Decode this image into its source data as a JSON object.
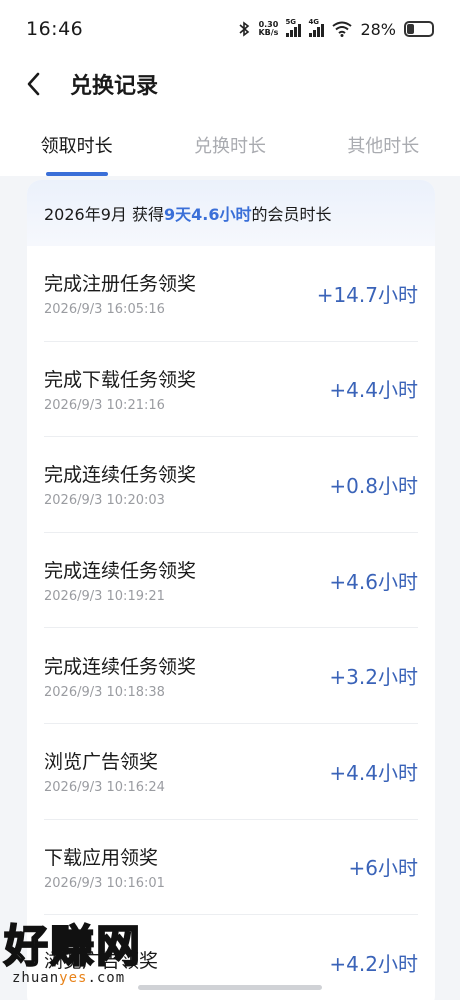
{
  "status_bar": {
    "time": "16:46",
    "bluetooth_icon": "bluetooth-icon",
    "net_speed_value": "0.30",
    "net_speed_unit": "KB/s",
    "signal1_label": "5G",
    "signal2_label": "4G",
    "battery_percent": "28%",
    "battery_level": 0.28
  },
  "nav": {
    "back_icon": "chevron-left-icon",
    "title": "兑换记录"
  },
  "tabs": [
    {
      "label": "领取时长",
      "active": true
    },
    {
      "label": "兑换时长",
      "active": false
    },
    {
      "label": "其他时长",
      "active": false
    }
  ],
  "summary": {
    "prefix": "2026年9月 获得",
    "highlight": "9天4.6小时",
    "suffix": "的会员时长"
  },
  "records": [
    {
      "title": "完成注册任务领奖",
      "time": "2026/9/3 16:05:16",
      "amount": "+14.7小时"
    },
    {
      "title": "完成下载任务领奖",
      "time": "2026/9/3 10:21:16",
      "amount": "+4.4小时"
    },
    {
      "title": "完成连续任务领奖",
      "time": "2026/9/3 10:20:03",
      "amount": "+0.8小时"
    },
    {
      "title": "完成连续任务领奖",
      "time": "2026/9/3 10:19:21",
      "amount": "+4.6小时"
    },
    {
      "title": "完成连续任务领奖",
      "time": "2026/9/3 10:18:38",
      "amount": "+3.2小时"
    },
    {
      "title": "浏览广告领奖",
      "time": "2026/9/3 10:16:24",
      "amount": "+4.4小时"
    },
    {
      "title": "下载应用领奖",
      "time": "2026/9/3 10:16:01",
      "amount": "+6小时"
    },
    {
      "title": "浏览广告领奖",
      "time": "",
      "amount": "+4.2小时"
    }
  ],
  "watermark": {
    "main": "好赚网",
    "sub_pre": "zhuan",
    "sub_acc": "yes",
    "sub_post": ".com"
  },
  "colors": {
    "accent": "#3a6fd8",
    "amount": "#3a63b8",
    "background": "#f3f5f8"
  }
}
